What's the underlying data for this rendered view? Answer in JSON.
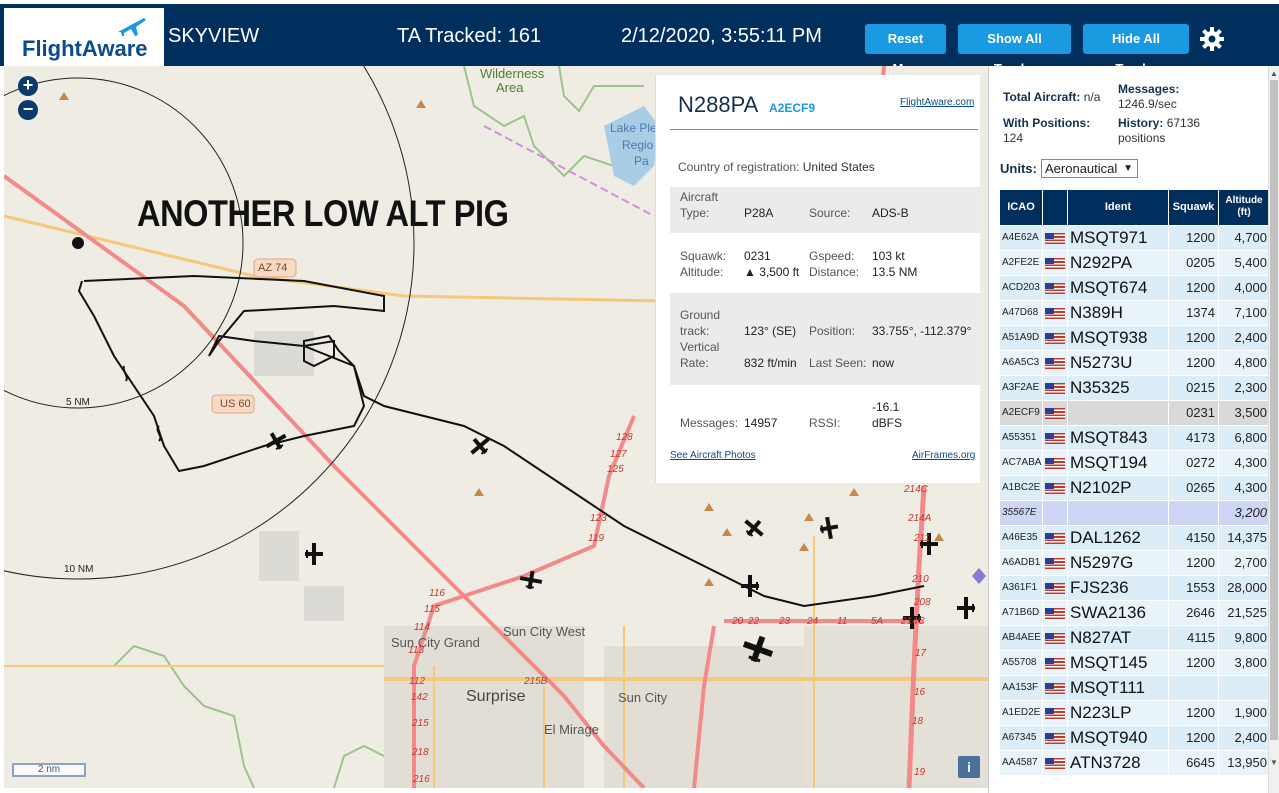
{
  "header": {
    "logo_text": "FlightAware",
    "app_name": "SKYVIEW",
    "tracked": "TA Tracked: 161",
    "datetime": "2/12/2020, 3:55:11 PM",
    "reset_label": "Reset Map",
    "show_label": "Show All Tracks",
    "hide_label": "Hide All Tracks",
    "settings_icon": "gear-icon"
  },
  "map": {
    "annotation": "ANOTHER LOW ALT PIG",
    "zoom_in": "+",
    "zoom_out": "−",
    "scale": "2 nm",
    "info": "i",
    "labels": {
      "wilderness": "Wilderness",
      "area": "Area",
      "lake_pleasant_1": "Lake Ple",
      "lake_pleasant_2": "Regio",
      "lake_pleasant_3": "Pa",
      "az74": "AZ 74",
      "us60": "US 60",
      "ring_5": "5 NM",
      "ring_10": "10 NM",
      "sun_city_grand": "Sun City Grand",
      "sun_city_west": "Sun City West",
      "surprise": "Surprise",
      "sun_city": "Sun City",
      "el_mirage": "El Mirage"
    },
    "route_numbers": [
      "128",
      "127",
      "125",
      "123",
      "119",
      "116",
      "115",
      "114",
      "113",
      "112",
      "142",
      "215",
      "218",
      "216",
      "215B",
      "214C",
      "214A",
      "211",
      "210",
      "208",
      "17",
      "16",
      "18",
      "19",
      "20",
      "22",
      "23",
      "24",
      "11",
      "5A",
      "214C"
    ],
    "colors": {
      "track": "#111111",
      "highway": "#f28a8a",
      "road": "#f6c87a",
      "park": "#8dbb7a"
    }
  },
  "popup": {
    "callsign": "N288PA",
    "hex": "A2ECF9",
    "fa_link": "FlightAware.com",
    "country_label": "Country of registration:",
    "country_value": "United States",
    "aircraft_type_label_1": "Aircraft",
    "aircraft_type_label_2": "Type:",
    "aircraft_type_value": "P28A",
    "source_label": "Source:",
    "source_value": "ADS-B",
    "squawk_label": "Squawk:",
    "squawk_value": "0231",
    "gspeed_label": "Gspeed:",
    "gspeed_value": "103 kt",
    "altitude_label": "Altitude:",
    "altitude_value": "▲ 3,500 ft",
    "distance_label": "Distance:",
    "distance_value": "13.5 NM",
    "ground_track_label_1": "Ground",
    "ground_track_label_2": "track:",
    "ground_track_value": "123° (SE)",
    "position_label": "Position:",
    "position_value": "33.755°, -112.379°",
    "vertical_rate_label_1": "Vertical",
    "vertical_rate_label_2": "Rate:",
    "vertical_rate_value": "832 ft/min",
    "last_seen_label": "Last Seen:",
    "last_seen_value": "now",
    "messages_label": "Messages:",
    "messages_value": "14957",
    "rssi_label": "RSSI:",
    "rssi_value_1": "-16.1",
    "rssi_value_2": "dBFS",
    "photos_link": "See Aircraft Photos",
    "airframes_link": "AirFrames.org"
  },
  "panel": {
    "total_aircraft_label": "Total Aircraft:",
    "total_aircraft_value": "n/a",
    "messages_label": "Messages:",
    "messages_value": "1246.9/sec",
    "with_positions_label": "With Positions:",
    "with_positions_value": "124",
    "history_label": "History:",
    "history_value": "67136",
    "history_unit": "positions",
    "units_label": "Units:",
    "units_value": "Aeronautical",
    "columns": [
      "ICAO",
      "",
      "Ident",
      "Squawk",
      "Altitude (ft)"
    ],
    "rows": [
      {
        "icao": "A4E62A",
        "ident": "MSQT971",
        "squawk": "1200",
        "alt": "4,700"
      },
      {
        "icao": "A2FE2E",
        "ident": "N292PA",
        "squawk": "0205",
        "alt": "5,400"
      },
      {
        "icao": "ACD203",
        "ident": "MSQT674",
        "squawk": "1200",
        "alt": "4,000"
      },
      {
        "icao": "A47D68",
        "ident": "N389H",
        "squawk": "1374",
        "alt": "7,100"
      },
      {
        "icao": "A51A9D",
        "ident": "MSQT938",
        "squawk": "1200",
        "alt": "2,400"
      },
      {
        "icao": "A6A5C3",
        "ident": "N5273U",
        "squawk": "1200",
        "alt": "4,800"
      },
      {
        "icao": "A3F2AE",
        "ident": "N35325",
        "squawk": "0215",
        "alt": "2,300"
      },
      {
        "icao": "A2ECF9",
        "ident": "",
        "squawk": "0231",
        "alt": "3,500",
        "selected": true
      },
      {
        "icao": "A55351",
        "ident": "MSQT843",
        "squawk": "4173",
        "alt": "6,800"
      },
      {
        "icao": "AC7ABA",
        "ident": "MSQT194",
        "squawk": "0272",
        "alt": "4,300"
      },
      {
        "icao": "A1BC2E",
        "ident": "N2102P",
        "squawk": "0265",
        "alt": "4,300"
      },
      {
        "icao": "35567E",
        "ident": "",
        "squawk": "",
        "alt": "3,200",
        "noflag": true,
        "mlat": true
      },
      {
        "icao": "A46E35",
        "ident": "DAL1262",
        "squawk": "4150",
        "alt": "14,375"
      },
      {
        "icao": "A6ADB1",
        "ident": "N5297G",
        "squawk": "1200",
        "alt": "2,700"
      },
      {
        "icao": "A361F1",
        "ident": "FJS236",
        "squawk": "1553",
        "alt": "28,000"
      },
      {
        "icao": "A71B6D",
        "ident": "SWA2136",
        "squawk": "2646",
        "alt": "21,525"
      },
      {
        "icao": "AB4AEE",
        "ident": "N827AT",
        "squawk": "4115",
        "alt": "9,800"
      },
      {
        "icao": "A55708",
        "ident": "MSQT145",
        "squawk": "1200",
        "alt": "3,800"
      },
      {
        "icao": "AA153F",
        "ident": "MSQT111",
        "squawk": "",
        "alt": ""
      },
      {
        "icao": "A1ED2E",
        "ident": "N223LP",
        "squawk": "1200",
        "alt": "1,900"
      },
      {
        "icao": "A67345",
        "ident": "MSQT940",
        "squawk": "1200",
        "alt": "2,400"
      },
      {
        "icao": "AA4587",
        "ident": "ATN3728",
        "squawk": "6645",
        "alt": "13,950"
      }
    ],
    "row_colors": {
      "even": "#dcedf7",
      "odd": "#e8f4fa",
      "selected": "#d9d9d9",
      "mlat": "#cfd6f4"
    }
  }
}
